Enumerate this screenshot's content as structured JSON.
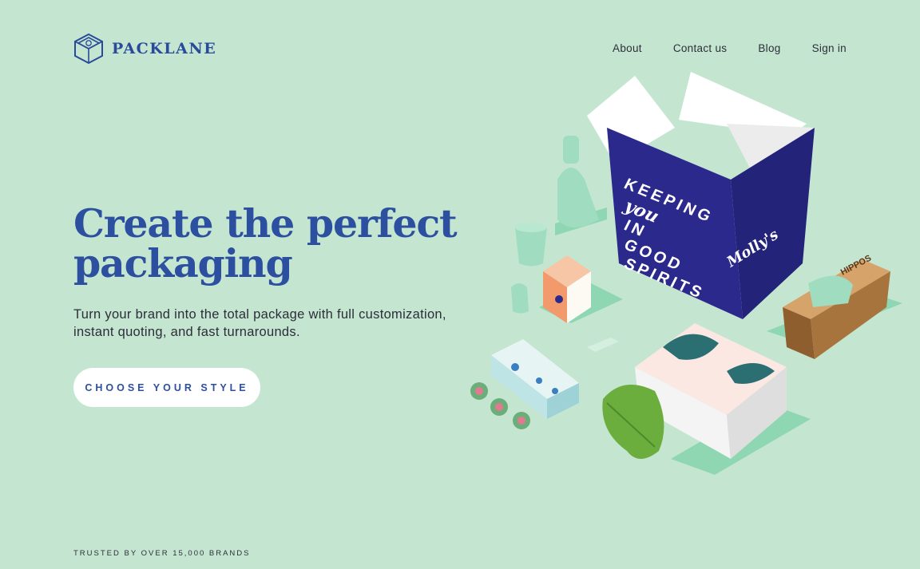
{
  "brand": {
    "name": "PACKLANE"
  },
  "nav": {
    "items": [
      {
        "label": "About"
      },
      {
        "label": "Contact us"
      },
      {
        "label": "Blog"
      },
      {
        "label": "Sign in"
      }
    ]
  },
  "hero": {
    "headline_line1": "Create the perfect",
    "headline_line2": "packaging",
    "subtitle": "Turn your brand into the total package with full customization, instant quoting, and fast turnarounds.",
    "cta_label": "CHOOSE YOUR STYLE",
    "box_text": [
      "KEEPING",
      "you",
      "IN",
      "GOOD",
      "SPIRITS"
    ],
    "box_brand": "Molly's",
    "hippo_label": "HIPPOS"
  },
  "footer": {
    "trusted": "TRUSTED BY OVER 15,000 BRANDS"
  },
  "colors": {
    "background": "#c4e6d0",
    "accent": "#2d4fa0",
    "box_navy": "#2b2a8c"
  }
}
